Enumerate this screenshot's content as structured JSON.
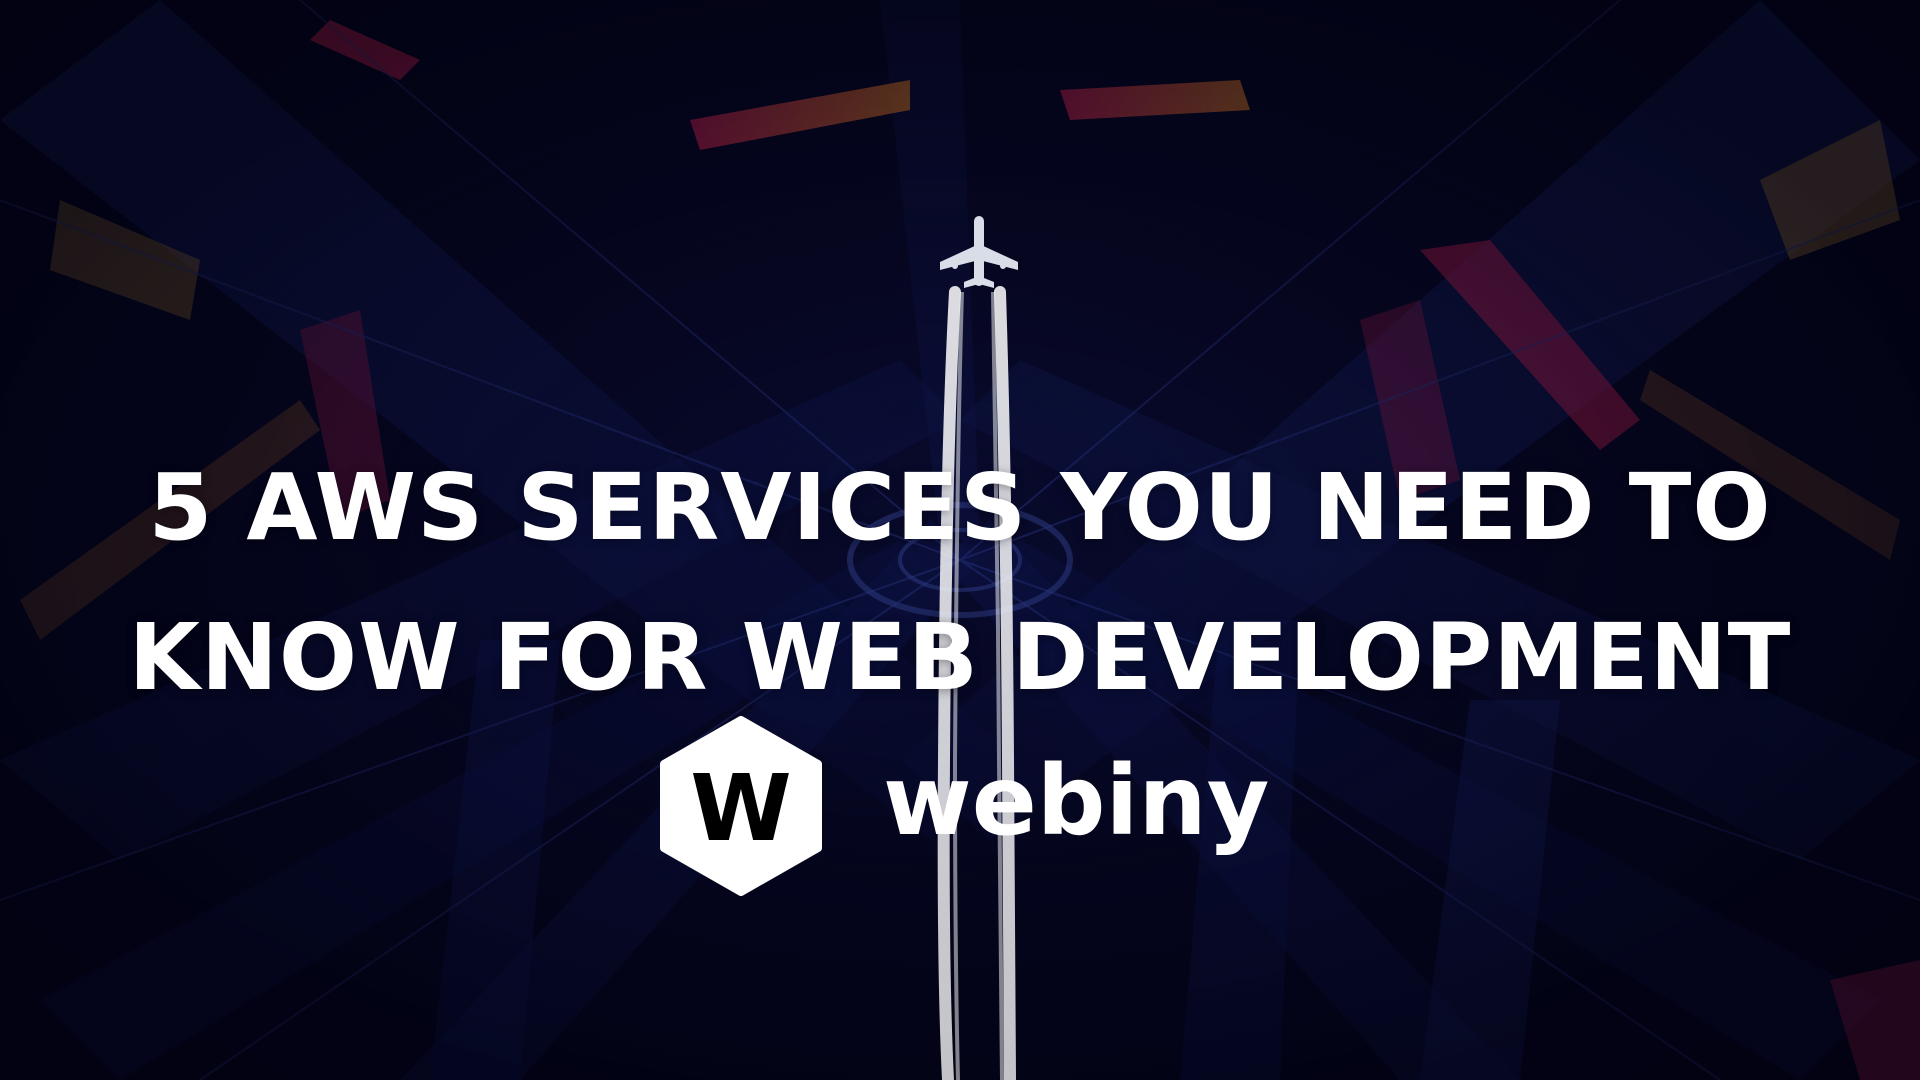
{
  "headline": {
    "line1": "5 AWS SERVICES YOU NEED TO",
    "line2": "KNOW FOR WEB DEVELOPMENT"
  },
  "brand": {
    "wordmark": "webiny",
    "mark_letter": "W"
  },
  "colors": {
    "background": "#05061a",
    "text": "#ffffff",
    "accent_red": "#e1245b",
    "accent_orange": "#f28a2a"
  },
  "icons": {
    "airplane": "airplane-icon",
    "logo_mark": "hexagon-w-logo-icon"
  }
}
